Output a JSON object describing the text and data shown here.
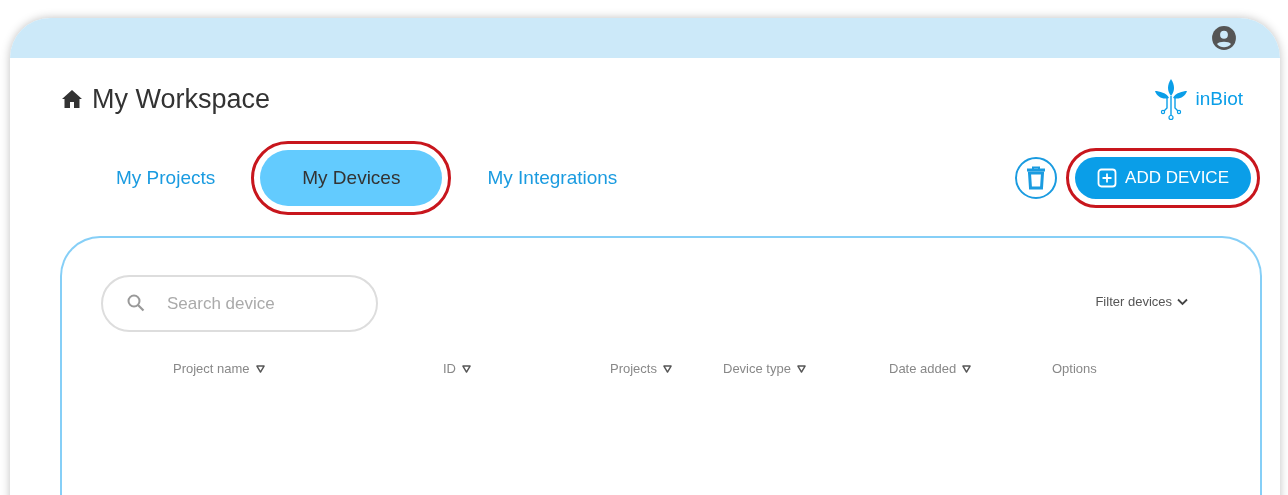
{
  "workspace": {
    "title": "My Workspace"
  },
  "brand": {
    "name": "inBiot"
  },
  "tabs": [
    {
      "label": "My Projects",
      "selected": false,
      "highlighted": false
    },
    {
      "label": "My Devices",
      "selected": true,
      "highlighted": true
    },
    {
      "label": "My Integrations",
      "selected": false,
      "highlighted": false
    }
  ],
  "add_button": {
    "label": "ADD DEVICE",
    "highlighted": true
  },
  "search": {
    "placeholder": "Search device"
  },
  "filter": {
    "label": "Filter devices"
  },
  "table": {
    "columns": [
      {
        "label": "Project name",
        "sortable": true
      },
      {
        "label": "ID",
        "sortable": true
      },
      {
        "label": "Projects",
        "sortable": true
      },
      {
        "label": "Device type",
        "sortable": true
      },
      {
        "label": "Date added",
        "sortable": true
      },
      {
        "label": "Options",
        "sortable": false
      }
    ]
  }
}
